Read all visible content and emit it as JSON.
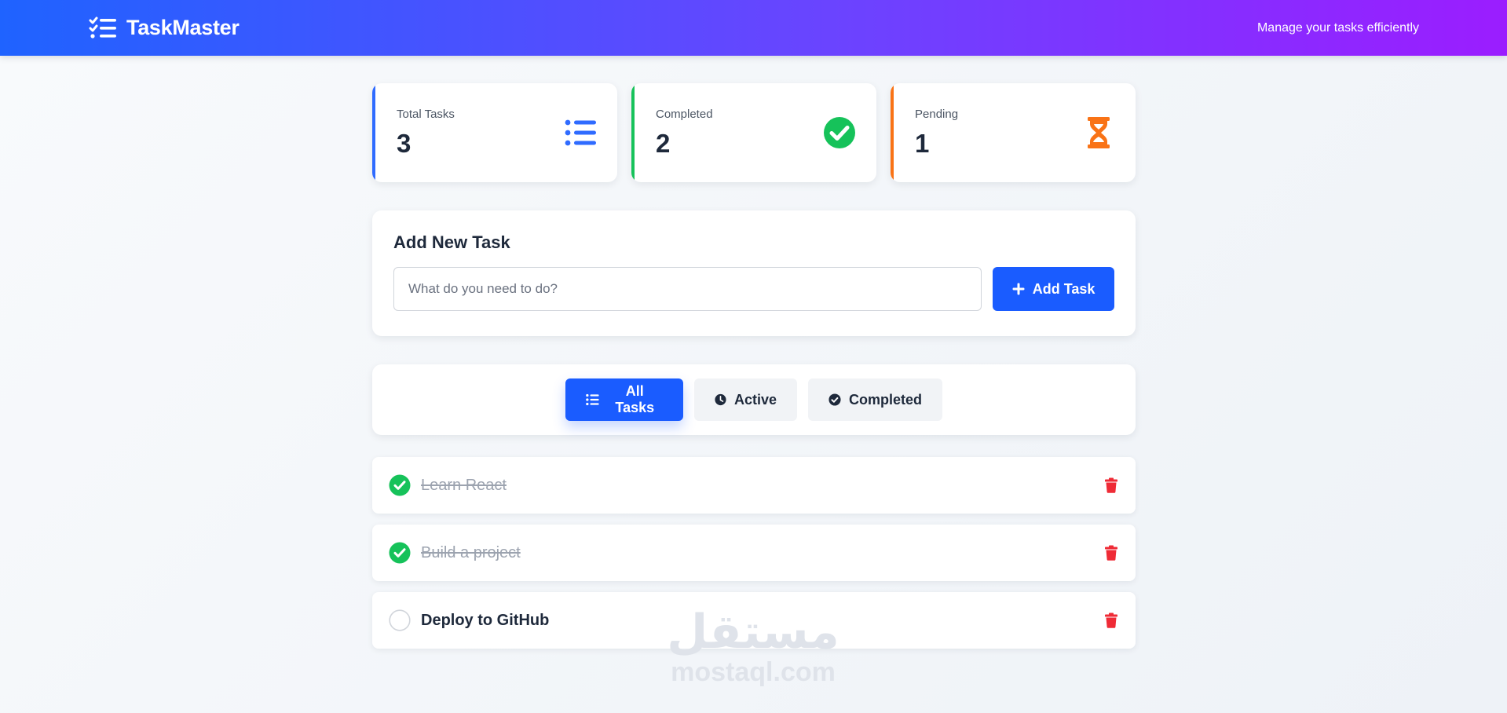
{
  "header": {
    "brand": "TaskMaster",
    "tagline": "Manage your tasks efficiently",
    "gradient": [
      "#1f63ff",
      "#6a44ff",
      "#9b1dff"
    ]
  },
  "stats": [
    {
      "label": "Total Tasks",
      "value": "3",
      "icon": "list-icon",
      "accent": "#2f6bff"
    },
    {
      "label": "Completed",
      "value": "2",
      "icon": "check-circle-icon",
      "accent": "#16c25a"
    },
    {
      "label": "Pending",
      "value": "1",
      "icon": "hourglass-icon",
      "accent": "#f97316"
    }
  ],
  "add_task": {
    "title": "Add New Task",
    "placeholder": "What do you need to do?",
    "value": "",
    "button_label": "Add Task"
  },
  "filters": [
    {
      "label": "All Tasks",
      "icon": "list-icon",
      "active": true
    },
    {
      "label": "Active",
      "icon": "clock-icon",
      "active": false
    },
    {
      "label": "Completed",
      "icon": "check-circle-icon",
      "active": false
    }
  ],
  "tasks": [
    {
      "text": "Learn React",
      "completed": true
    },
    {
      "text": "Build a project",
      "completed": true
    },
    {
      "text": "Deploy to GitHub",
      "completed": false
    }
  ],
  "watermark": {
    "arabic": "مستقل",
    "latin": "mostaql.com"
  },
  "colors": {
    "primary": "#1a5cff",
    "danger": "#ef2b36",
    "success": "#16c25a"
  }
}
